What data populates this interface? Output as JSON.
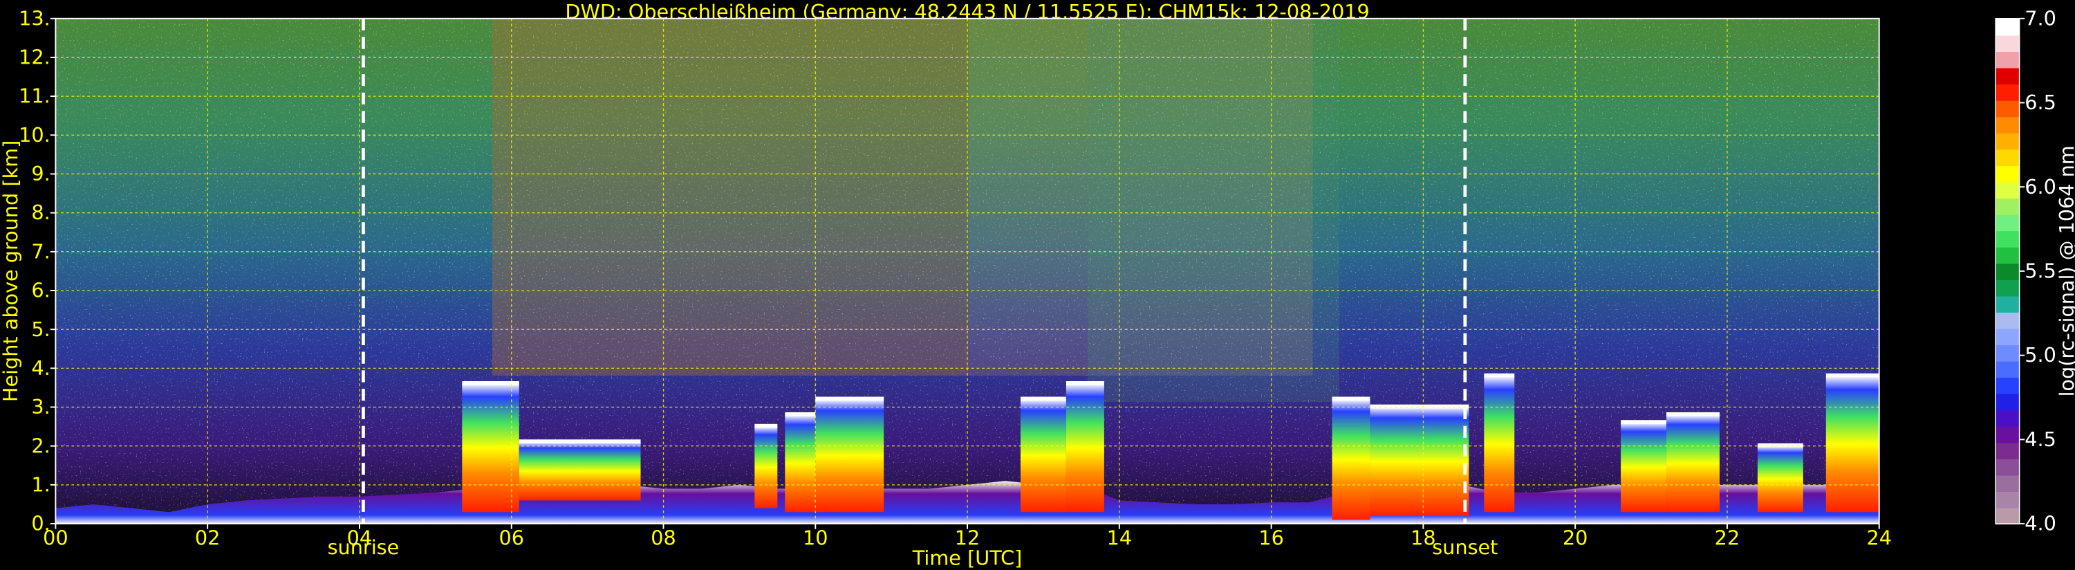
{
  "chart_data": {
    "type": "heatmap",
    "title": "DWD: Oberschleißheim (Germany; 48.2443 N / 11.5525 E):    CHM15k: 12-08-2019",
    "xlabel": "Time [UTC]",
    "ylabel": "Height above ground [km]",
    "x_ticks": [
      "00",
      "02",
      "04",
      "06",
      "08",
      "10",
      "12",
      "14",
      "16",
      "18",
      "20",
      "22",
      "24"
    ],
    "y_ticks": [
      "0.",
      "1.",
      "2.",
      "3.",
      "4.",
      "5.",
      "6.",
      "7.",
      "8.",
      "9.",
      "10.",
      "11.",
      "12.",
      "13."
    ],
    "xlim": [
      0,
      24
    ],
    "ylim": [
      0,
      13
    ],
    "grid": true,
    "colorbar": {
      "label": "log(rc-signal) @ 1064 nm",
      "ticks": [
        "4.0",
        "4.5",
        "5.0",
        "5.5",
        "6.0",
        "6.5",
        "7.0"
      ],
      "range": [
        4.0,
        7.0
      ],
      "colors": [
        "#b89aa8",
        "#a885a8",
        "#9a6fa0",
        "#8a4f98",
        "#7a2c8f",
        "#6a0fa0",
        "#4a10c8",
        "#2020e6",
        "#2840ff",
        "#4a6cff",
        "#6f8cff",
        "#8ea6ff",
        "#a8bcf0",
        "#20b0a0",
        "#10a050",
        "#0a8a2a",
        "#22c040",
        "#40e060",
        "#70f080",
        "#a0f060",
        "#e0ff40",
        "#ffff00",
        "#ffd800",
        "#ffb000",
        "#ff8c00",
        "#ff5a00",
        "#ff1e00",
        "#e00000",
        "#f0a0a8",
        "#f8d8dc",
        "#ffffff"
      ]
    },
    "annotations": [
      {
        "label": "sunrise",
        "x": 4.05
      },
      {
        "label": "sunset",
        "x": 18.55
      }
    ],
    "aerosol_layer_top_km": [
      [
        0.0,
        0.4
      ],
      [
        0.5,
        0.5
      ],
      [
        1.0,
        0.4
      ],
      [
        1.5,
        0.3
      ],
      [
        2.0,
        0.5
      ],
      [
        2.5,
        0.6
      ],
      [
        3.0,
        0.65
      ],
      [
        3.5,
        0.7
      ],
      [
        4.0,
        0.7
      ],
      [
        4.5,
        0.75
      ],
      [
        5.0,
        0.8
      ],
      [
        5.5,
        0.9
      ],
      [
        6.0,
        1.0
      ],
      [
        6.5,
        1.1
      ],
      [
        7.0,
        1.0
      ],
      [
        7.5,
        1.0
      ],
      [
        8.0,
        0.9
      ],
      [
        8.5,
        0.9
      ],
      [
        9.0,
        1.0
      ],
      [
        9.5,
        0.9
      ],
      [
        10.0,
        0.9
      ],
      [
        10.5,
        0.9
      ],
      [
        11.0,
        0.9
      ],
      [
        11.5,
        0.9
      ],
      [
        12.0,
        1.0
      ],
      [
        12.5,
        1.1
      ],
      [
        13.0,
        1.0
      ],
      [
        13.5,
        1.0
      ],
      [
        14.0,
        0.6
      ],
      [
        14.5,
        0.55
      ],
      [
        15.0,
        0.5
      ],
      [
        15.5,
        0.5
      ],
      [
        16.0,
        0.55
      ],
      [
        16.5,
        0.55
      ],
      [
        17.0,
        0.8
      ],
      [
        17.5,
        1.0
      ],
      [
        18.0,
        1.0
      ],
      [
        18.5,
        1.0
      ],
      [
        19.0,
        0.8
      ],
      [
        19.5,
        0.8
      ],
      [
        20.0,
        0.9
      ],
      [
        20.5,
        1.0
      ],
      [
        21.0,
        1.0
      ],
      [
        21.5,
        1.0
      ],
      [
        22.0,
        1.0
      ],
      [
        22.5,
        1.0
      ],
      [
        23.0,
        1.0
      ],
      [
        23.5,
        1.0
      ],
      [
        24.0,
        1.0
      ]
    ],
    "cloud_segments": [
      {
        "x0": 5.35,
        "x1": 6.1,
        "base_km": 0.3,
        "top_km": 3.6
      },
      {
        "x0": 6.1,
        "x1": 7.7,
        "base_km": 0.6,
        "top_km": 2.1
      },
      {
        "x0": 9.2,
        "x1": 9.5,
        "base_km": 0.4,
        "top_km": 2.5
      },
      {
        "x0": 9.6,
        "x1": 10.0,
        "base_km": 0.3,
        "top_km": 2.8
      },
      {
        "x0": 10.0,
        "x1": 10.9,
        "base_km": 0.3,
        "top_km": 3.2
      },
      {
        "x0": 12.7,
        "x1": 13.3,
        "base_km": 0.3,
        "top_km": 3.2
      },
      {
        "x0": 13.3,
        "x1": 13.8,
        "base_km": 0.3,
        "top_km": 3.6
      },
      {
        "x0": 16.8,
        "x1": 17.3,
        "base_km": 0.1,
        "top_km": 3.2
      },
      {
        "x0": 17.3,
        "x1": 18.6,
        "base_km": 0.2,
        "top_km": 3.0
      },
      {
        "x0": 18.8,
        "x1": 19.2,
        "base_km": 0.3,
        "top_km": 3.8
      },
      {
        "x0": 20.6,
        "x1": 21.2,
        "base_km": 0.3,
        "top_km": 2.6
      },
      {
        "x0": 21.2,
        "x1": 21.9,
        "base_km": 0.3,
        "top_km": 2.8
      },
      {
        "x0": 22.4,
        "x1": 23.0,
        "base_km": 0.3,
        "top_km": 2.0
      },
      {
        "x0": 23.3,
        "x1": 24.0,
        "base_km": 0.3,
        "top_km": 3.8
      }
    ]
  }
}
